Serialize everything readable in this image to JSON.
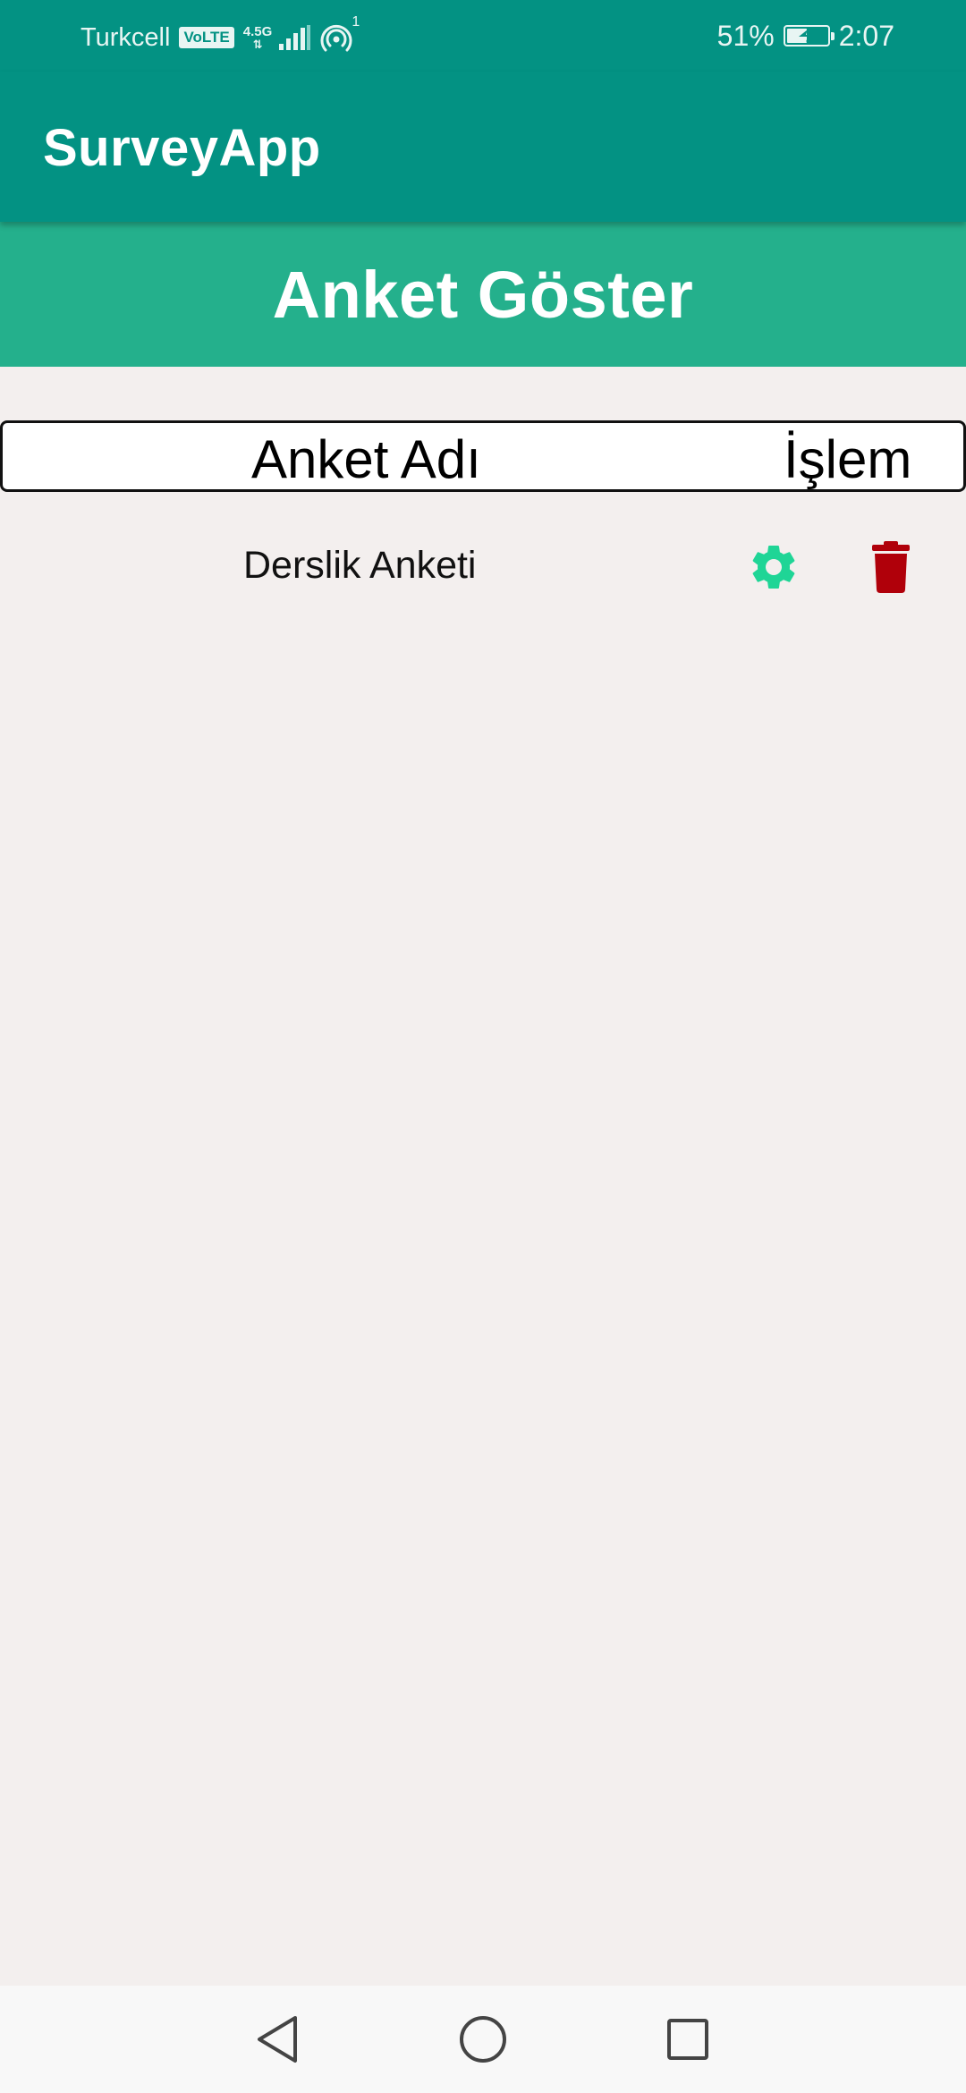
{
  "status_bar": {
    "carrier": "Turkcell",
    "volte": "VoLTE",
    "network_type": "4.5G",
    "sim_slot": "1",
    "battery_percent": "51%",
    "battery_level": 0.51,
    "time": "2:07"
  },
  "app_bar": {
    "title": "SurveyApp"
  },
  "page": {
    "title": "Anket Göster"
  },
  "table": {
    "columns": [
      "Anket Adı",
      "İşlem"
    ],
    "rows": [
      {
        "name": "Derslik Anketi",
        "actions": [
          "gear-icon",
          "trash-icon"
        ]
      }
    ]
  },
  "colors": {
    "status_bar": "#039283",
    "app_bar": "#039283",
    "page_header": "#24b08c",
    "background": "#f3efee",
    "settings_icon": "#1fd596",
    "delete_icon": "#b0000a"
  },
  "nav_bar": {
    "buttons": [
      "back-icon",
      "home-icon",
      "recents-icon"
    ]
  }
}
